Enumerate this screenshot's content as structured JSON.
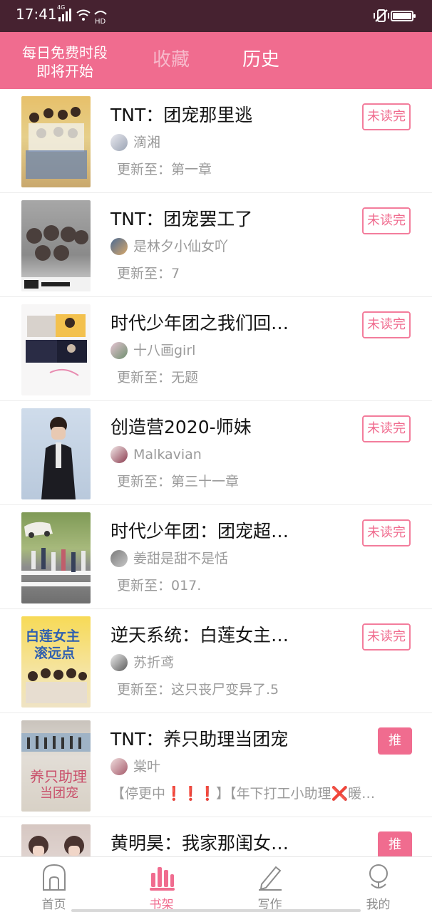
{
  "status_bar": {
    "time": "17:41",
    "network": "4G",
    "hd": "HD"
  },
  "header": {
    "promo_line1": "每日免费时段",
    "promo_line2": "即将开始",
    "tab_favorites": "收藏",
    "tab_history": "历史"
  },
  "books": [
    {
      "title": "TNT：团宠那里逃",
      "author": "滴湘",
      "update": "更新至：第一章",
      "badge": "未读完"
    },
    {
      "title": "TNT：团宠罢工了",
      "author": "是林夕小仙女吖",
      "update": "更新至：7",
      "badge": "未读完"
    },
    {
      "title": "时代少年团之我们回…",
      "author": "十八画girl",
      "update": "更新至：无题",
      "badge": "未读完"
    },
    {
      "title": "创造营2020-师妹",
      "author": "Malkavian",
      "update": "更新至：第三十一章",
      "badge": "未读完"
    },
    {
      "title": "时代少年团：团宠超…",
      "author": "姜甜是甜不是恬",
      "update": "更新至：017.",
      "badge": "未读完"
    },
    {
      "title": "逆天系统：白莲女主…",
      "author": "苏折鸢",
      "update": "更新至：这只丧尸变异了.5",
      "badge": "未读完"
    },
    {
      "title": "TNT：养只助理当团宠",
      "author": "棠叶",
      "update": "【停更中❗❗❗】【年下打工小助理❌暖…",
      "badge": "推荐"
    },
    {
      "title": "黄明昊：我家那闺女…",
      "author": "",
      "update": "",
      "badge": "推荐"
    }
  ],
  "nav": {
    "home": "首页",
    "bookshelf": "书架",
    "write": "写作",
    "mine": "我的"
  },
  "colors": {
    "accent": "#f06c8f",
    "status_bar": "#462230"
  }
}
